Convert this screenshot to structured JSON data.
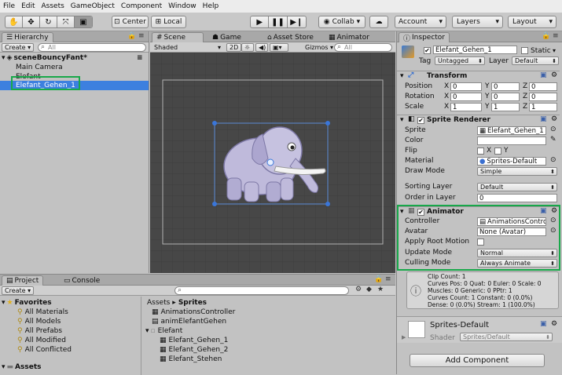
{
  "menu": [
    "File",
    "Edit",
    "Assets",
    "GameObject",
    "Component",
    "Window",
    "Help"
  ],
  "toolbar": {
    "center": "Center",
    "local": "Local",
    "collab": "Collab",
    "account": "Account",
    "layers": "Layers",
    "layout": "Layout"
  },
  "hierarchy": {
    "tab": "Hierarchy",
    "create": "Create",
    "search": "All",
    "scene": "sceneBouncyFant*",
    "items": [
      "Main Camera",
      "Elefant",
      "Elefant_Gehen_1"
    ]
  },
  "scene": {
    "tabs": [
      "Scene",
      "Game",
      "Asset Store",
      "Animator"
    ],
    "shading": "Shaded",
    "mode2d": "2D",
    "gizmos": "Gizmos",
    "search": "All"
  },
  "inspector": {
    "tab": "Inspector",
    "object_name": "Elefant_Gehen_1",
    "static_label": "Static",
    "tag_label": "Tag",
    "tag_value": "Untagged",
    "layer_label": "Layer",
    "layer_value": "Default",
    "transform": {
      "title": "Transform",
      "rows": [
        {
          "label": "Position",
          "x": "0",
          "y": "0",
          "z": "0"
        },
        {
          "label": "Rotation",
          "x": "0",
          "y": "0",
          "z": "0"
        },
        {
          "label": "Scale",
          "x": "1",
          "y": "1",
          "z": "1"
        }
      ]
    },
    "sprite_renderer": {
      "title": "Sprite Renderer",
      "sprite_label": "Sprite",
      "sprite_value": "Elefant_Gehen_1",
      "color_label": "Color",
      "flip_label": "Flip",
      "flip_x": "X",
      "flip_y": "Y",
      "material_label": "Material",
      "material_value": "Sprites-Default",
      "draw_mode_label": "Draw Mode",
      "draw_mode_value": "Simple",
      "sorting_layer_label": "Sorting Layer",
      "sorting_layer_value": "Default",
      "order_label": "Order in Layer",
      "order_value": "0"
    },
    "animator": {
      "title": "Animator",
      "controller_label": "Controller",
      "controller_value": "AnimationsContro",
      "avatar_label": "Avatar",
      "avatar_value": "None (Avatar)",
      "root_motion_label": "Apply Root Motion",
      "update_label": "Update Mode",
      "update_value": "Normal",
      "culling_label": "Culling Mode",
      "culling_value": "Always Animate"
    },
    "info": {
      "clip": "Clip Count: 1",
      "curves": "Curves Pos: 0 Quat: 0 Euler: 0 Scale: 0",
      "muscles": "Muscles: 0 Generic: 0 PPtr: 1",
      "curves_count": "Curves Count: 1 Constant: 0 (0.0%)",
      "dense": "Dense: 0 (0.0%) Stream: 1 (100.0%)"
    },
    "material": {
      "name": "Sprites-Default",
      "shader_label": "Shader",
      "shader_value": "Sprites/Default"
    },
    "add_component": "Add Component"
  },
  "project": {
    "tabs": [
      "Project",
      "Console"
    ],
    "create": "Create",
    "favorites_label": "Favorites",
    "favorites": [
      "All Materials",
      "All Models",
      "All Prefabs",
      "All Modified",
      "All Conflicted"
    ],
    "assets_label": "Assets",
    "breadcrumb_root": "Assets",
    "breadcrumb_sep": "▸",
    "breadcrumb_leaf": "Sprites",
    "files": [
      "AnimationsController",
      "animElefantGehen",
      "Elefant",
      "Elefant_Gehen_1",
      "Elefant_Gehen_2",
      "Elefant_Stehen"
    ]
  },
  "colors": {
    "selection": "#3d80df",
    "highlight": "#18a84a",
    "scene_bg": "#474747"
  }
}
